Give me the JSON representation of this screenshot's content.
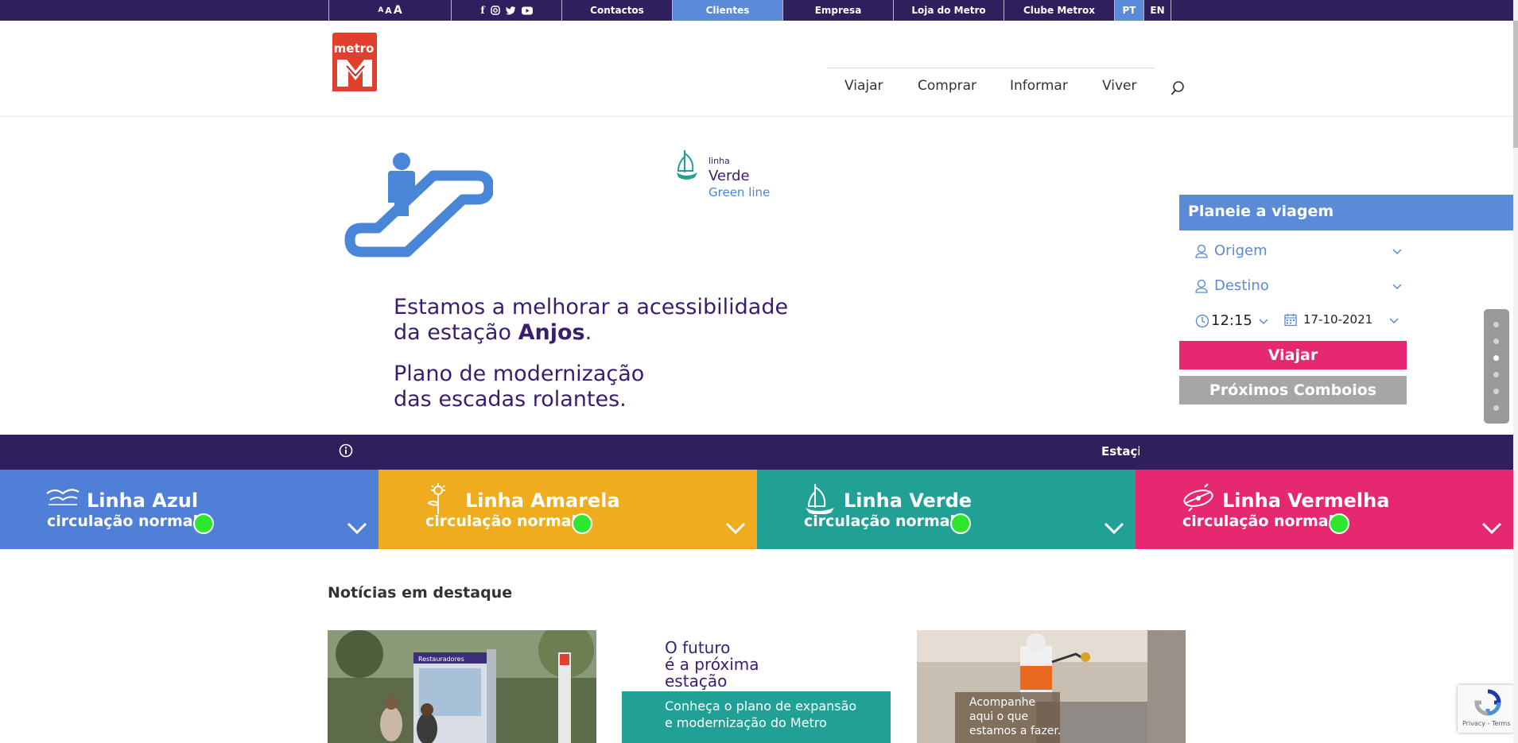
{
  "topbar": {
    "font_size_label": "A A A",
    "social": [
      "facebook-icon",
      "instagram-icon",
      "twitter-icon",
      "youtube-icon"
    ],
    "links": [
      "Contactos",
      "Clientes",
      "Empresa",
      "Loja do Metro",
      "Clube Metrox"
    ],
    "active_link": "Clientes",
    "languages": [
      "PT",
      "EN"
    ],
    "active_language": "PT"
  },
  "header": {
    "logo_text": "metro",
    "nav": [
      "Viajar",
      "Comprar",
      "Informar",
      "Viver"
    ]
  },
  "hero": {
    "badge_small": "linha",
    "badge_line": "Verde",
    "badge_line_en": "Green line",
    "line1": "Estamos a melhorar a acessibilidade",
    "line2_prefix": "da estação ",
    "line2_bold": "Anjos",
    "line2_suffix": ".",
    "line3": "Plano de modernização",
    "line4": "das escadas rolantes."
  },
  "planner": {
    "title": "Planeie a viagem",
    "origin": "Origem",
    "destination": "Destino",
    "time": "12:15",
    "date": "17-10-2021",
    "travel_button": "Viajar",
    "next_trains_button": "Próximos Comboios"
  },
  "slider": {
    "dots": 6,
    "active_dot": 2
  },
  "infobar": {
    "ticker_text": "Estaçi"
  },
  "lines": [
    {
      "name": "Linha Azul",
      "status": "circulação normal",
      "color": "#4f7fd6",
      "icon": "seagull-icon"
    },
    {
      "name": "Linha Amarela",
      "status": "circulação normal",
      "color": "#efac1f",
      "icon": "sunflower-icon"
    },
    {
      "name": "Linha Verde",
      "status": "circulação normal",
      "color": "#21a096",
      "icon": "caravel-icon"
    },
    {
      "name": "Linha Vermelha",
      "status": "circulação normal",
      "color": "#e5286f",
      "icon": "compass-icon"
    }
  ],
  "news": {
    "title": "Notícias em destaque",
    "card2_headline_1": "O futuro",
    "card2_headline_2": "é a próxima",
    "card2_headline_3": "estação",
    "card2_caption_1": "Conheça o plano de expansão",
    "card2_caption_2": "e modernização do Metro",
    "card3_caption_1": "Acompanhe",
    "card3_caption_2": "aqui o que",
    "card3_caption_3": "estamos a fazer.",
    "card1_sign": "Restauradores"
  },
  "recaptcha": {
    "terms": "Privacy - Terms"
  },
  "colors": {
    "purple": "#2f1f5c",
    "blue": "#5b8ad8",
    "pink": "#e5286f",
    "grey_button": "#a6a6a6",
    "logo_red": "#e0402e"
  }
}
